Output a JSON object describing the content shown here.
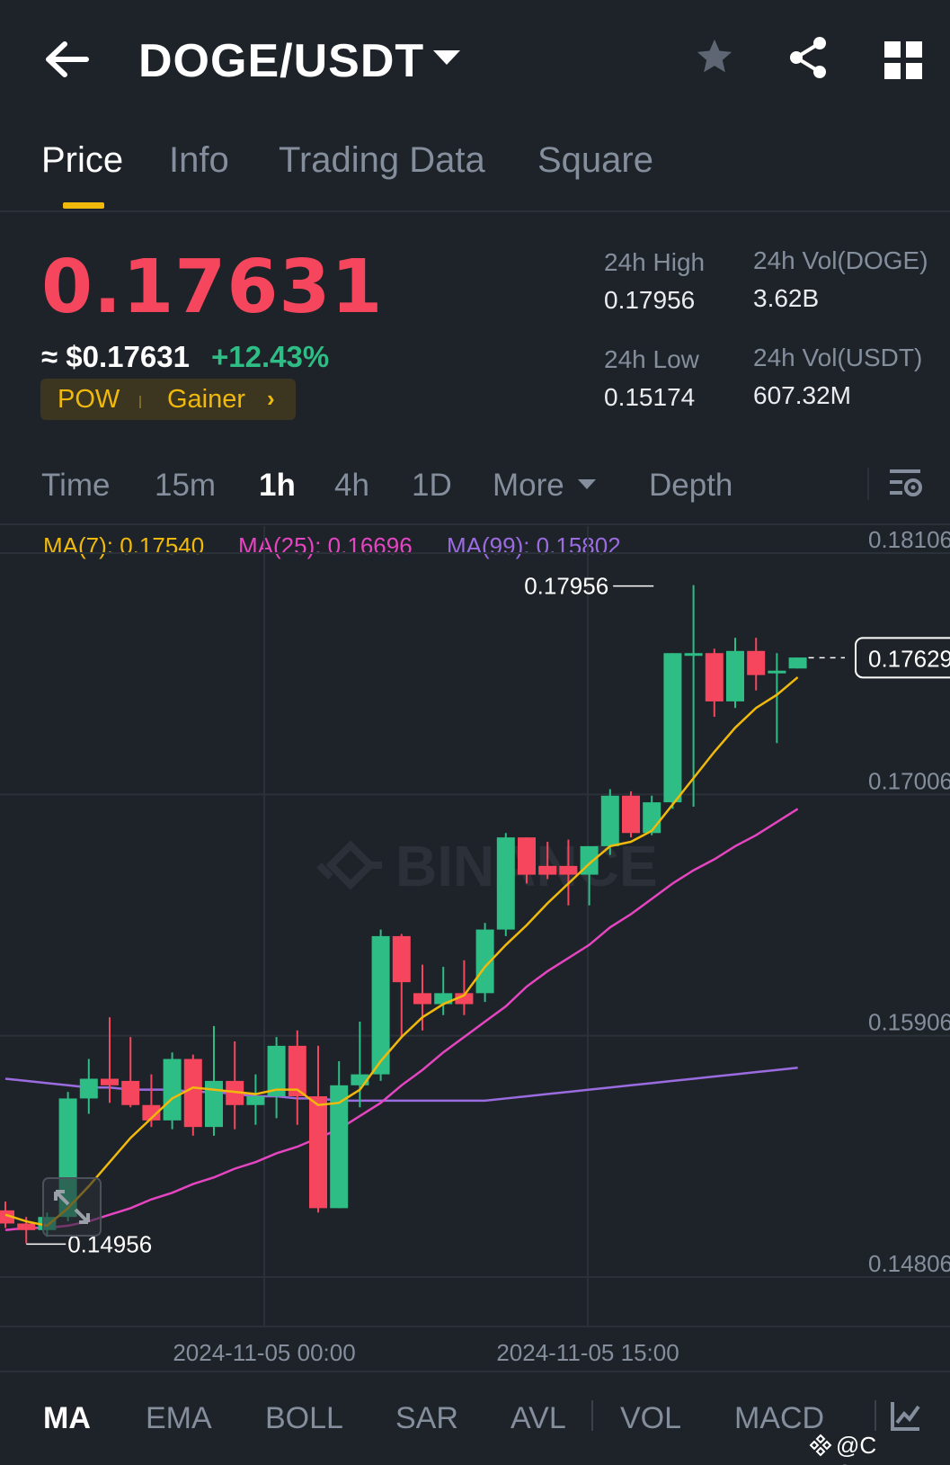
{
  "header": {
    "pair": "DOGE/USDT",
    "icons": [
      "back-arrow-icon",
      "chevron-down-icon",
      "star-icon",
      "share-icon",
      "grid-icon"
    ]
  },
  "tabs": [
    {
      "label": "Price",
      "active": true
    },
    {
      "label": "Info"
    },
    {
      "label": "Trading Data"
    },
    {
      "label": "Square"
    }
  ],
  "price": {
    "last": "0.17631",
    "usd": "≈ $0.17631",
    "change": "+12.43%",
    "tags": [
      "POW",
      "Gainer"
    ],
    "tag_chevron": "›"
  },
  "stats": {
    "high_label": "24h High",
    "high": "0.17956",
    "low_label": "24h Low",
    "low": "0.15174",
    "vol_doge_label": "24h Vol(DOGE)",
    "vol_doge": "3.62B",
    "vol_usdt_label": "24h Vol(USDT)",
    "vol_usdt": "607.32M"
  },
  "timeframes": [
    "Time",
    "15m",
    "1h",
    "4h",
    "1D",
    "More",
    "Depth"
  ],
  "timeframe_active": "1h",
  "ma_legend": {
    "ma7": "MA(7): 0.17540",
    "ma25": "MA(25): 0.16696",
    "ma99": "MA(99): 0.15802"
  },
  "colors": {
    "up": "#2ebd85",
    "down": "#f6465d",
    "ma7": "#f0b90b",
    "ma25": "#e545c0",
    "ma99": "#9a6ce0",
    "bg": "#1e2329"
  },
  "chart_data": {
    "type": "candlestick",
    "y_ticks": [
      "0.18106",
      "0.17006",
      "0.15906",
      "0.14806"
    ],
    "ylim": [
      0.14806,
      0.18106
    ],
    "x_ticks": [
      "2024-11-05 00:00",
      "2024-11-05 15:00"
    ],
    "current_price_label": "0.17629",
    "high_marker": "0.17956",
    "low_marker": "0.14956",
    "watermark": "BINANCE",
    "candles": [
      [
        0.1511,
        0.1515,
        0.1503,
        0.1505
      ],
      [
        0.1505,
        0.1508,
        0.1496,
        0.1502
      ],
      [
        0.1502,
        0.151,
        0.1499,
        0.1508
      ],
      [
        0.1508,
        0.1565,
        0.1506,
        0.1562
      ],
      [
        0.1562,
        0.158,
        0.1555,
        0.1571
      ],
      [
        0.1571,
        0.1599,
        0.156,
        0.1568
      ],
      [
        0.157,
        0.159,
        0.1558,
        0.1559
      ],
      [
        0.1559,
        0.1573,
        0.1549,
        0.1552
      ],
      [
        0.1552,
        0.1583,
        0.1548,
        0.158
      ],
      [
        0.158,
        0.1582,
        0.1545,
        0.1549
      ],
      [
        0.1549,
        0.1595,
        0.1545,
        0.157
      ],
      [
        0.157,
        0.1588,
        0.1548,
        0.1559
      ],
      [
        0.1559,
        0.1573,
        0.155,
        0.1563
      ],
      [
        0.1563,
        0.159,
        0.1553,
        0.1586
      ],
      [
        0.1586,
        0.1593,
        0.155,
        0.1563
      ],
      [
        0.1563,
        0.1586,
        0.151,
        0.1512
      ],
      [
        0.1512,
        0.1579,
        0.1512,
        0.1568
      ],
      [
        0.1568,
        0.1597,
        0.1558,
        0.1573
      ],
      [
        0.1573,
        0.1639,
        0.157,
        0.1636
      ],
      [
        0.1636,
        0.1637,
        0.159,
        0.1615
      ],
      [
        0.161,
        0.1623,
        0.1593,
        0.1605
      ],
      [
        0.1605,
        0.1622,
        0.16,
        0.161
      ],
      [
        0.161,
        0.1625,
        0.16,
        0.1605
      ],
      [
        0.161,
        0.1642,
        0.1606,
        0.1639
      ],
      [
        0.1639,
        0.1683,
        0.1636,
        0.1681
      ],
      [
        0.1681,
        0.168,
        0.166,
        0.1664
      ],
      [
        0.1668,
        0.1679,
        0.1662,
        0.1664
      ],
      [
        0.1668,
        0.168,
        0.165,
        0.1664
      ],
      [
        0.1664,
        0.1677,
        0.165,
        0.1677
      ],
      [
        0.1677,
        0.1703,
        0.1673,
        0.17
      ],
      [
        0.17,
        0.1702,
        0.1681,
        0.1683
      ],
      [
        0.1683,
        0.17,
        0.1682,
        0.1697
      ],
      [
        0.1697,
        0.1757,
        0.1694,
        0.1765
      ],
      [
        0.1765,
        0.1796,
        0.1695,
        0.1765
      ],
      [
        0.1765,
        0.1767,
        0.1736,
        0.1743
      ],
      [
        0.1743,
        0.1772,
        0.174,
        0.1766
      ],
      [
        0.1766,
        0.1772,
        0.1748,
        0.1755
      ],
      [
        0.1757,
        0.1765,
        0.1724,
        0.1757
      ],
      [
        0.1758,
        0.1763,
        0.1758,
        0.1763
      ]
    ],
    "ma7": [
      0.1509,
      0.1506,
      0.1504,
      0.1512,
      0.1522,
      0.1533,
      0.1544,
      0.1553,
      0.1562,
      0.1567,
      0.1566,
      0.1565,
      0.1564,
      0.1566,
      0.1566,
      0.1559,
      0.156,
      0.1566,
      0.1579,
      0.159,
      0.1599,
      0.1605,
      0.1609,
      0.1622,
      0.1632,
      0.1641,
      0.1651,
      0.166,
      0.1669,
      0.1677,
      0.1679,
      0.1684,
      0.1696,
      0.1708,
      0.172,
      0.1731,
      0.174,
      0.1746,
      0.1754
    ],
    "ma25": [
      0.1502,
      0.1503,
      0.1503,
      0.1504,
      0.1506,
      0.1509,
      0.1512,
      0.1516,
      0.1519,
      0.1523,
      0.1526,
      0.153,
      0.1533,
      0.1537,
      0.154,
      0.1544,
      0.1548,
      0.1554,
      0.156,
      0.1568,
      0.1575,
      0.1583,
      0.159,
      0.1597,
      0.1604,
      0.1613,
      0.162,
      0.1626,
      0.1632,
      0.164,
      0.1646,
      0.1653,
      0.166,
      0.1666,
      0.1671,
      0.1677,
      0.1682,
      0.1688,
      0.1694
    ],
    "ma99": [
      0.1571,
      0.157,
      0.1569,
      0.1568,
      0.1567,
      0.1567,
      0.1566,
      0.1566,
      0.1566,
      0.1565,
      0.1565,
      0.1564,
      0.1563,
      0.1563,
      0.1562,
      0.1562,
      0.1561,
      0.1561,
      0.1561,
      0.1561,
      0.1561,
      0.1561,
      0.1561,
      0.1561,
      0.1562,
      0.1563,
      0.1564,
      0.1565,
      0.1566,
      0.1567,
      0.1568,
      0.1569,
      0.157,
      0.1571,
      0.1572,
      0.1573,
      0.1574,
      0.1575,
      0.1576
    ]
  },
  "indicators": [
    "MA",
    "EMA",
    "BOLL",
    "SAR",
    "AVL",
    "VOL",
    "MACD"
  ],
  "watermark_user": "@C Queen"
}
